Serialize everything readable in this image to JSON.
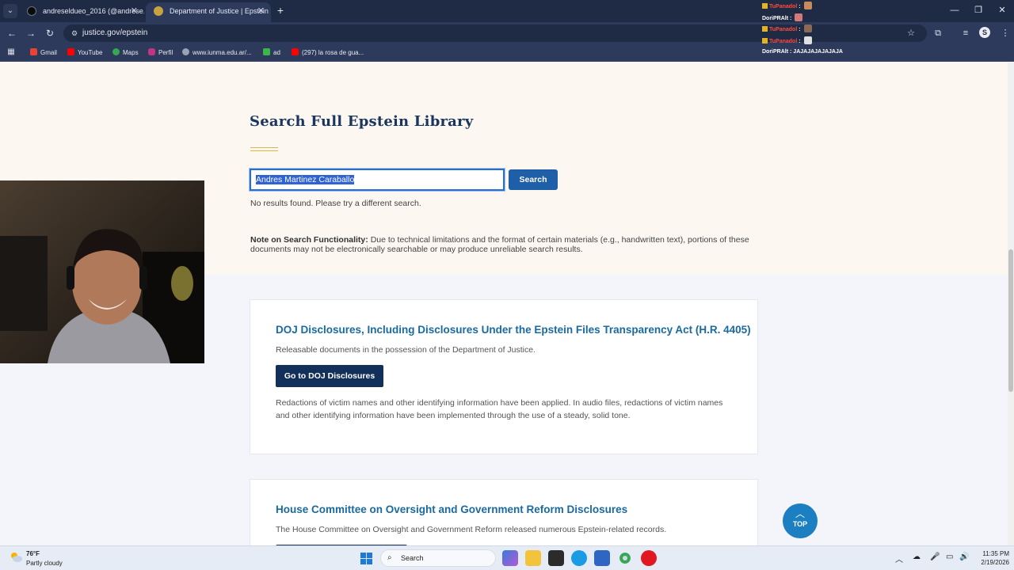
{
  "browser": {
    "tabs": [
      {
        "title": "andreseldueo_2016 (@andrese...",
        "active": false
      },
      {
        "title": "Department of Justice | Epstein",
        "active": true
      }
    ],
    "url": "justice.gov/epstein",
    "bookmarks": [
      "Gmail",
      "YouTube",
      "Maps",
      "Perfil",
      "www.iunma.edu.ar/...",
      "ad",
      "(297) la rosa de gua..."
    ],
    "profile_initial": "S"
  },
  "chat": [
    {
      "user": "TuPanadol",
      "message": ""
    },
    {
      "user": "DoriPRAlt",
      "message": ""
    },
    {
      "user": "TuPanadol",
      "message": ""
    },
    {
      "user": "TuPanadol",
      "message": ""
    },
    {
      "user": "DoriPRAlt",
      "message": "JAJAJAJAJAJAJA"
    }
  ],
  "search": {
    "title": "Search Full Epstein Library",
    "query": "Andres Martinez Caraballo",
    "button": "Search",
    "no_results": "No results found. Please try a different search.",
    "note_label": "Note on Search Functionality:",
    "note_text": "Due to technical limitations and the format of certain materials (e.g., handwritten text), portions of these documents may not be electronically searchable or may produce unreliable search results."
  },
  "cards": [
    {
      "title": "DOJ Disclosures, Including Disclosures Under the Epstein Files Transparency Act (H.R. 4405)",
      "subtitle": "Releasable documents in the possession of the Department of Justice.",
      "button": "Go to DOJ Disclosures",
      "body": "Redactions of victim names and other identifying information have been applied. In audio files, redactions of victim names and other identifying information have been implemented through the use of a steady, solid tone."
    },
    {
      "title": "House Committee on Oversight and Government Reform Disclosures",
      "subtitle": "The House Committee on Oversight and Government Reform released numerous Epstein-related records."
    }
  ],
  "top_button": "TOP",
  "taskbar": {
    "weather_temp": "76°F",
    "weather_desc": "Partly cloudy",
    "search_label": "Search",
    "time": "11:35 PM",
    "date": "2/19/2026"
  }
}
